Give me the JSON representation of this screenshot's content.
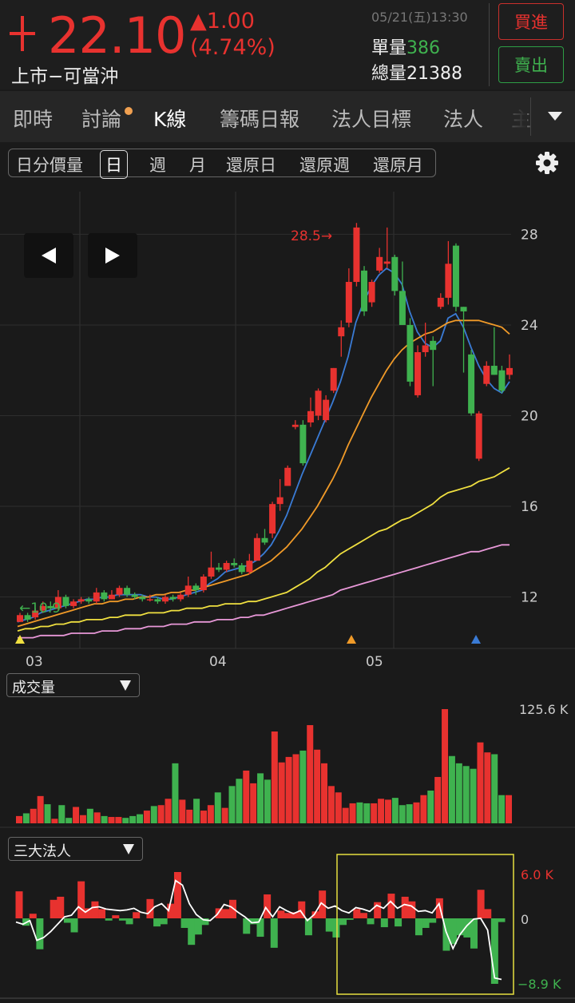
{
  "quote": {
    "price": "22.10",
    "change": "▲1.00",
    "change_pct": "(4.74%)",
    "stock_name": "上市−可當沖",
    "datetime": "05/21(五)13:30",
    "single_volume_label": "單量",
    "single_volume": "386",
    "total_volume_label": "總量",
    "total_volume": "21388"
  },
  "actions": {
    "buy": "買進",
    "sell": "賣出"
  },
  "tabs": [
    "即時",
    "討論",
    "K線",
    "籌碼日報",
    "法人目標",
    "法人",
    "主"
  ],
  "active_tab": "K線",
  "periods": [
    "日分價量",
    "日",
    "週",
    "月",
    "還原日",
    "還原週",
    "還原月"
  ],
  "selected_period": "日",
  "indicators": {
    "volume": "成交量",
    "institutional": "三大法人"
  },
  "colors": {
    "up": "#e8322f",
    "down": "#3fb24f",
    "ma5": "#3a7bd5",
    "ma20": "#f09a28",
    "ma60": "#f0e040",
    "ma120": "#e898d8",
    "inst_line": "#ffffff",
    "highlight": "#e6e040"
  },
  "chart_data": [
    {
      "type": "candlestick",
      "price_axis": {
        "ticks": [
          "28",
          "24",
          "20",
          "16",
          "12"
        ],
        "ylim": [
          9.8,
          29.6
        ]
      },
      "x_labels": [
        "03",
        "04",
        "05"
      ],
      "annotations": {
        "high": "28.5→",
        "low": "←10.9"
      },
      "candles": [
        {
          "o": 10.9,
          "c": 11.2,
          "h": 11.3,
          "l": 10.9
        },
        {
          "o": 11.2,
          "c": 11.0,
          "h": 11.3,
          "l": 10.9
        },
        {
          "o": 11.1,
          "c": 11.4,
          "h": 11.5,
          "l": 11.0
        },
        {
          "o": 11.4,
          "c": 11.6,
          "h": 11.8,
          "l": 11.3
        },
        {
          "o": 11.6,
          "c": 11.5,
          "h": 11.8,
          "l": 11.4
        },
        {
          "o": 11.5,
          "c": 12.0,
          "h": 12.3,
          "l": 11.4
        },
        {
          "o": 12.0,
          "c": 11.6,
          "h": 12.1,
          "l": 11.5
        },
        {
          "o": 11.6,
          "c": 11.8,
          "h": 11.9,
          "l": 11.5
        },
        {
          "o": 11.8,
          "c": 11.9,
          "h": 12.0,
          "l": 11.7
        },
        {
          "o": 11.9,
          "c": 11.8,
          "h": 12.0,
          "l": 11.7
        },
        {
          "o": 11.8,
          "c": 12.2,
          "h": 12.4,
          "l": 11.7
        },
        {
          "o": 12.2,
          "c": 11.9,
          "h": 12.3,
          "l": 11.8
        },
        {
          "o": 11.9,
          "c": 12.1,
          "h": 12.3,
          "l": 11.9
        },
        {
          "o": 12.1,
          "c": 12.4,
          "h": 12.5,
          "l": 12.0
        },
        {
          "o": 12.4,
          "c": 12.1,
          "h": 12.5,
          "l": 12.0
        },
        {
          "o": 12.1,
          "c": 12.0,
          "h": 12.2,
          "l": 11.9
        },
        {
          "o": 12.0,
          "c": 11.9,
          "h": 12.1,
          "l": 11.8
        },
        {
          "o": 11.9,
          "c": 11.9,
          "h": 12.1,
          "l": 11.8
        },
        {
          "o": 11.9,
          "c": 11.8,
          "h": 12.0,
          "l": 11.7
        },
        {
          "o": 11.8,
          "c": 12.0,
          "h": 12.1,
          "l": 11.7
        },
        {
          "o": 12.0,
          "c": 11.9,
          "h": 12.1,
          "l": 11.8
        },
        {
          "o": 11.9,
          "c": 12.1,
          "h": 12.2,
          "l": 11.8
        },
        {
          "o": 12.1,
          "c": 12.5,
          "h": 12.9,
          "l": 12.0
        },
        {
          "o": 12.5,
          "c": 12.3,
          "h": 12.6,
          "l": 12.1
        },
        {
          "o": 12.3,
          "c": 12.9,
          "h": 13.0,
          "l": 12.2
        },
        {
          "o": 12.9,
          "c": 13.3,
          "h": 14.0,
          "l": 12.8
        },
        {
          "o": 13.3,
          "c": 13.2,
          "h": 13.5,
          "l": 13.1
        },
        {
          "o": 13.2,
          "c": 13.5,
          "h": 13.6,
          "l": 13.1
        },
        {
          "o": 13.5,
          "c": 13.4,
          "h": 13.7,
          "l": 13.3
        },
        {
          "o": 13.4,
          "c": 13.1,
          "h": 13.5,
          "l": 13.0
        },
        {
          "o": 13.1,
          "c": 13.6,
          "h": 13.9,
          "l": 13.0
        },
        {
          "o": 13.6,
          "c": 14.6,
          "h": 14.8,
          "l": 13.6
        },
        {
          "o": 14.6,
          "c": 14.4,
          "h": 15.0,
          "l": 14.3
        },
        {
          "o": 14.8,
          "c": 16.1,
          "h": 16.2,
          "l": 14.6
        },
        {
          "o": 16.1,
          "c": 16.4,
          "h": 17.2,
          "l": 15.8
        },
        {
          "o": 16.9,
          "c": 17.7,
          "h": 17.8,
          "l": 16.9
        },
        {
          "o": 19.5,
          "c": 19.6,
          "h": 19.8,
          "l": 19.4
        },
        {
          "o": 19.6,
          "c": 17.9,
          "h": 19.8,
          "l": 17.8
        },
        {
          "o": 19.7,
          "c": 20.2,
          "h": 20.8,
          "l": 19.5
        },
        {
          "o": 20.0,
          "c": 21.1,
          "h": 21.2,
          "l": 19.8
        },
        {
          "o": 19.8,
          "c": 20.7,
          "h": 20.9,
          "l": 19.7
        },
        {
          "o": 21.1,
          "c": 22.1,
          "h": 22.1,
          "l": 21.0
        },
        {
          "o": 23.5,
          "c": 23.9,
          "h": 24.2,
          "l": 22.6
        },
        {
          "o": 24.1,
          "c": 25.9,
          "h": 26.5,
          "l": 23.9
        },
        {
          "o": 25.9,
          "c": 28.3,
          "h": 28.5,
          "l": 25.7
        },
        {
          "o": 26.4,
          "c": 24.6,
          "h": 26.6,
          "l": 24.4
        },
        {
          "o": 25.0,
          "c": 25.9,
          "h": 26.0,
          "l": 24.8
        },
        {
          "o": 26.4,
          "c": 27.0,
          "h": 27.4,
          "l": 26.3
        },
        {
          "o": 26.7,
          "c": 26.8,
          "h": 28.3,
          "l": 26.5
        },
        {
          "o": 27.0,
          "c": 25.5,
          "h": 27.1,
          "l": 25.3
        },
        {
          "o": 25.5,
          "c": 24.0,
          "h": 26.8,
          "l": 24.0
        },
        {
          "o": 24.0,
          "c": 21.5,
          "h": 24.3,
          "l": 21.3
        },
        {
          "o": 20.9,
          "c": 22.8,
          "h": 23.1,
          "l": 20.8
        },
        {
          "o": 22.8,
          "c": 23.1,
          "h": 24.1,
          "l": 22.6
        },
        {
          "o": 23.3,
          "c": 22.9,
          "h": 23.5,
          "l": 21.3
        },
        {
          "o": 24.8,
          "c": 25.2,
          "h": 25.4,
          "l": 24.7
        },
        {
          "o": 25.2,
          "c": 26.7,
          "h": 27.7,
          "l": 24.9
        },
        {
          "o": 27.5,
          "c": 24.8,
          "h": 27.6,
          "l": 24.6
        },
        {
          "o": 24.8,
          "c": 24.6,
          "h": 24.8,
          "l": 21.9
        },
        {
          "o": 22.7,
          "c": 20.1,
          "h": 22.9,
          "l": 20.0
        },
        {
          "o": 18.1,
          "c": 20.1,
          "h": 20.2,
          "l": 18.0
        },
        {
          "o": 21.4,
          "c": 22.2,
          "h": 22.4,
          "l": 21.3
        },
        {
          "o": 22.2,
          "c": 21.8,
          "h": 23.9,
          "l": 21.8
        },
        {
          "o": 22.0,
          "c": 21.1,
          "h": 22.2,
          "l": 21.0
        },
        {
          "o": 21.8,
          "c": 22.1,
          "h": 22.7,
          "l": 21.6
        }
      ],
      "ma": {
        "ma5": [
          10.9,
          11.0,
          11.1,
          11.3,
          11.4,
          11.5,
          11.6,
          11.7,
          11.8,
          11.9,
          11.9,
          12.0,
          12.0,
          12.1,
          12.1,
          12.1,
          12.1,
          12.0,
          12.0,
          11.9,
          11.9,
          12.0,
          12.1,
          12.2,
          12.3,
          12.6,
          12.8,
          13.1,
          13.2,
          13.3,
          13.4,
          13.6,
          13.9,
          14.3,
          14.9,
          15.6,
          16.5,
          17.4,
          18.2,
          19.0,
          19.8,
          20.6,
          21.5,
          22.6,
          24.1,
          25.0,
          25.7,
          26.2,
          26.5,
          26.3,
          25.8,
          24.6,
          23.7,
          23.2,
          23.0,
          23.3,
          24.3,
          24.5,
          23.9,
          23.0,
          22.2,
          21.6,
          21.2,
          21.0,
          21.5
        ],
        "ma20": [
          10.7,
          10.8,
          10.9,
          11.0,
          11.1,
          11.2,
          11.3,
          11.4,
          11.5,
          11.6,
          11.7,
          11.7,
          11.8,
          11.8,
          11.9,
          11.9,
          12.0,
          12.0,
          12.1,
          12.1,
          12.2,
          12.2,
          12.3,
          12.3,
          12.4,
          12.5,
          12.6,
          12.7,
          12.8,
          12.9,
          13.0,
          13.2,
          13.4,
          13.6,
          13.9,
          14.2,
          14.6,
          15.0,
          15.5,
          16.0,
          16.6,
          17.2,
          17.9,
          18.7,
          19.4,
          20.1,
          20.8,
          21.4,
          22.0,
          22.5,
          22.9,
          23.2,
          23.4,
          23.6,
          23.7,
          23.9,
          24.1,
          24.2,
          24.2,
          24.2,
          24.2,
          24.1,
          24.0,
          23.9,
          23.6
        ],
        "ma60": [
          10.5,
          10.6,
          10.6,
          10.7,
          10.7,
          10.8,
          10.8,
          10.9,
          10.9,
          11.0,
          11.0,
          11.0,
          11.1,
          11.1,
          11.2,
          11.2,
          11.2,
          11.3,
          11.3,
          11.3,
          11.4,
          11.4,
          11.5,
          11.5,
          11.5,
          11.6,
          11.6,
          11.7,
          11.7,
          11.7,
          11.8,
          11.8,
          11.9,
          12.0,
          12.1,
          12.2,
          12.4,
          12.6,
          12.8,
          13.1,
          13.3,
          13.6,
          13.9,
          14.1,
          14.3,
          14.5,
          14.7,
          14.9,
          15.0,
          15.2,
          15.4,
          15.5,
          15.7,
          15.9,
          16.1,
          16.4,
          16.6,
          16.7,
          16.8,
          16.9,
          17.1,
          17.2,
          17.3,
          17.5,
          17.7
        ],
        "ma120": [
          10.2,
          10.2,
          10.2,
          10.3,
          10.3,
          10.3,
          10.3,
          10.4,
          10.4,
          10.4,
          10.4,
          10.5,
          10.5,
          10.5,
          10.6,
          10.6,
          10.6,
          10.7,
          10.7,
          10.7,
          10.8,
          10.8,
          10.8,
          10.9,
          10.9,
          10.9,
          11.0,
          11.0,
          11.0,
          11.1,
          11.1,
          11.2,
          11.2,
          11.3,
          11.4,
          11.5,
          11.6,
          11.7,
          11.8,
          11.9,
          12.0,
          12.1,
          12.3,
          12.4,
          12.5,
          12.6,
          12.7,
          12.8,
          12.9,
          13.0,
          13.1,
          13.2,
          13.3,
          13.4,
          13.5,
          13.6,
          13.7,
          13.8,
          13.9,
          14.0,
          14.0,
          14.1,
          14.2,
          14.3,
          14.3
        ]
      }
    },
    {
      "type": "bar",
      "name": "成交量",
      "ymax_label": "125.6 K",
      "ymax": 125.6,
      "values": [
        8,
        11,
        16,
        30,
        21,
        5,
        20,
        6,
        18,
        9,
        16,
        12,
        8,
        7,
        7,
        6,
        8,
        10,
        14,
        19,
        20,
        27,
        66,
        26,
        15,
        27,
        14,
        20,
        34,
        17,
        41,
        49,
        58,
        44,
        55,
        48,
        101,
        67,
        73,
        76,
        80,
        108,
        81,
        66,
        41,
        34,
        17,
        22,
        23,
        22,
        22,
        27,
        26,
        28,
        20,
        21,
        23,
        31,
        36,
        51,
        125.6,
        74,
        66,
        63,
        60,
        89,
        78,
        76,
        31,
        31
      ]
    },
    {
      "type": "bar",
      "name": "三大法人",
      "ymax_label": "6.0 K",
      "zero_label": "0",
      "ymin_label": "−8.9 K",
      "ylim": [
        -8.9,
        6.0
      ],
      "values": [
        3.5,
        -1.0,
        0.6,
        -4.2,
        0,
        2.4,
        2.8,
        -0.6,
        -1.9,
        4.8,
        1.3,
        2.2,
        1.2,
        -0.3,
        0.4,
        -0.3,
        -0.8,
        0.8,
        0,
        2.5,
        -1.1,
        -0.8,
        1.9,
        6.0,
        -1.3,
        -3.6,
        -2.2,
        -0.9,
        0,
        1.3,
        1.2,
        2.4,
        0,
        -2.1,
        -0.8,
        -2.5,
        3.1,
        -4.0,
        1.0,
        0.7,
        0.8,
        2.2,
        -2.3,
        0.9,
        3.6,
        -1.8,
        -2.6,
        -0.9,
        -0.2,
        1.2,
        0.7,
        -0.8,
        2.1,
        -1.2,
        3.2,
        -1.1,
        2.8,
        2.2,
        -2.3,
        -1.3,
        -0.6,
        2.6,
        -4.4,
        -3.5,
        -2.3,
        -2.6,
        -4.1,
        3.7,
        1.2,
        -8.9,
        -0.5
      ],
      "line": [
        -0.5,
        -0.8,
        -0.3,
        -3.0,
        -2.6,
        -1.8,
        -0.8,
        0.2,
        0.4,
        1.5,
        0.8,
        1.4,
        1.5,
        1.2,
        1.1,
        1.0,
        1.1,
        1.3,
        0.8,
        0.6,
        1.5,
        1.9,
        1.0,
        4.9,
        4.3,
        1.9,
        0.5,
        -0.2,
        -0.3,
        0.5,
        1.8,
        1.5,
        0.8,
        0.2,
        -0.6,
        -0.5,
        1.4,
        0.2,
        1.5,
        1.0,
        0.6,
        1.0,
        -0.3,
        0.5,
        2.0,
        1.3,
        1.6,
        1.0,
        0.7,
        1.4,
        1.2,
        0.9,
        1.7,
        1.3,
        2.2,
        1.3,
        1.8,
        1.6,
        0.9,
        1.0,
        0.7,
        1.9,
        -1.8,
        -4.1,
        -2.2,
        -1.0,
        -0.1,
        0.0,
        -1.6,
        -8.1,
        -8.3
      ]
    }
  ]
}
